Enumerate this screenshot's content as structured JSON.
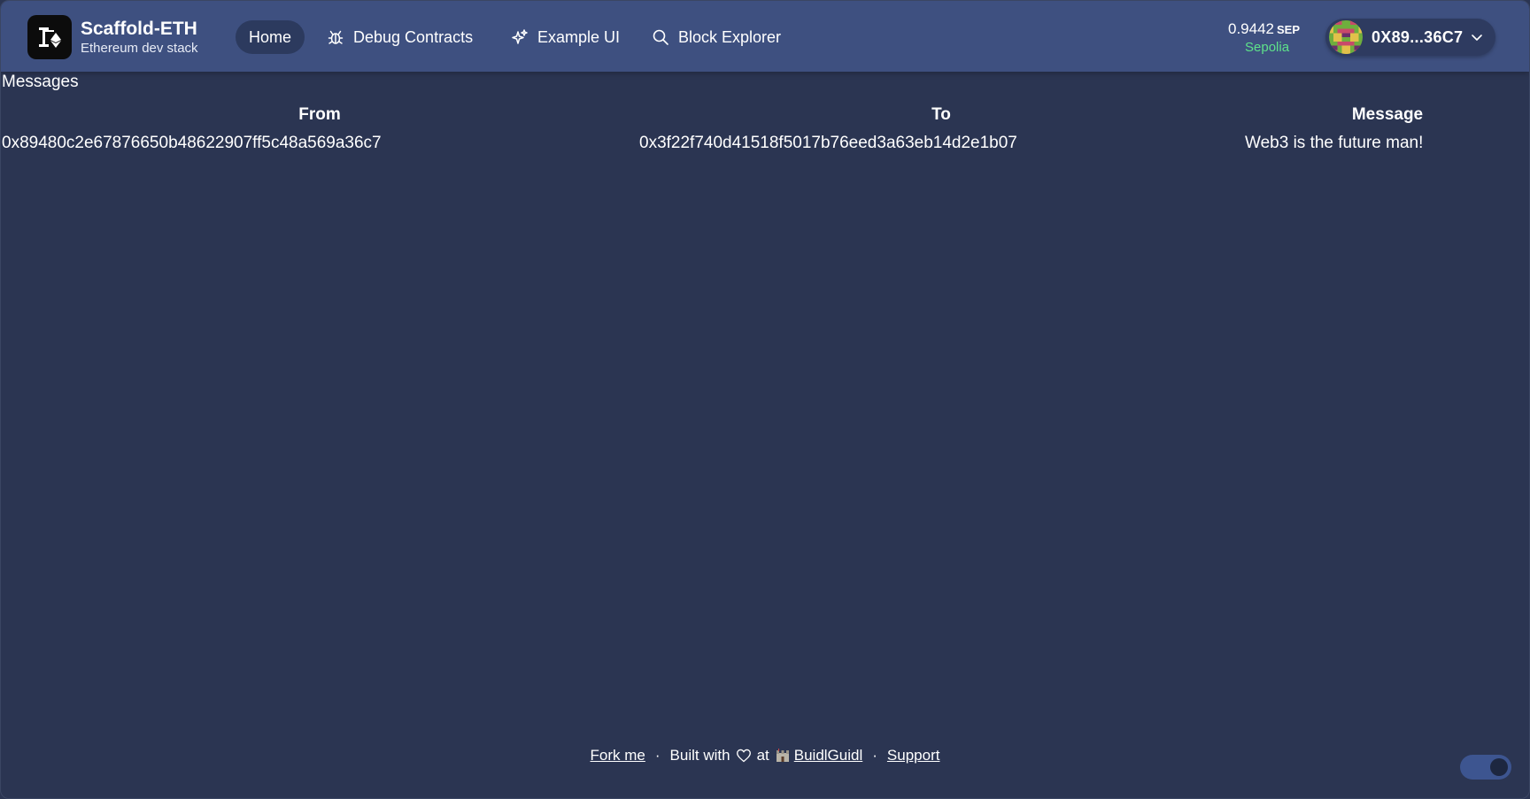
{
  "brand": {
    "title": "Scaffold-ETH",
    "subtitle": "Ethereum dev stack"
  },
  "nav": [
    {
      "label": "Home",
      "icon": "home",
      "active": true
    },
    {
      "label": "Debug Contracts",
      "icon": "bug-icon",
      "active": false
    },
    {
      "label": "Example UI",
      "icon": "sparkles-icon",
      "active": false
    },
    {
      "label": "Block Explorer",
      "icon": "search-icon",
      "active": false
    }
  ],
  "wallet": {
    "balance": "0.9442",
    "unit": "SEP",
    "network": "Sepolia",
    "account": "0X89...36C7"
  },
  "messages": {
    "title": "Messages",
    "columns": [
      "From",
      "To",
      "Message"
    ],
    "rows": [
      {
        "from": "0x89480c2e67876650b48622907ff5c48a569a36c7",
        "to": "0x3f22f740d41518f5017b76eed3a63eb14d2e1b07",
        "message": "Web3 is the future man!"
      }
    ]
  },
  "footer": {
    "fork": "Fork me",
    "built_with": "Built with",
    "at": "at",
    "buidlguidl": "BuidlGuidl",
    "support": "Support"
  },
  "colors": {
    "background": "#2b3552",
    "header": "#3e5080",
    "network_green": "#5ee28a"
  }
}
